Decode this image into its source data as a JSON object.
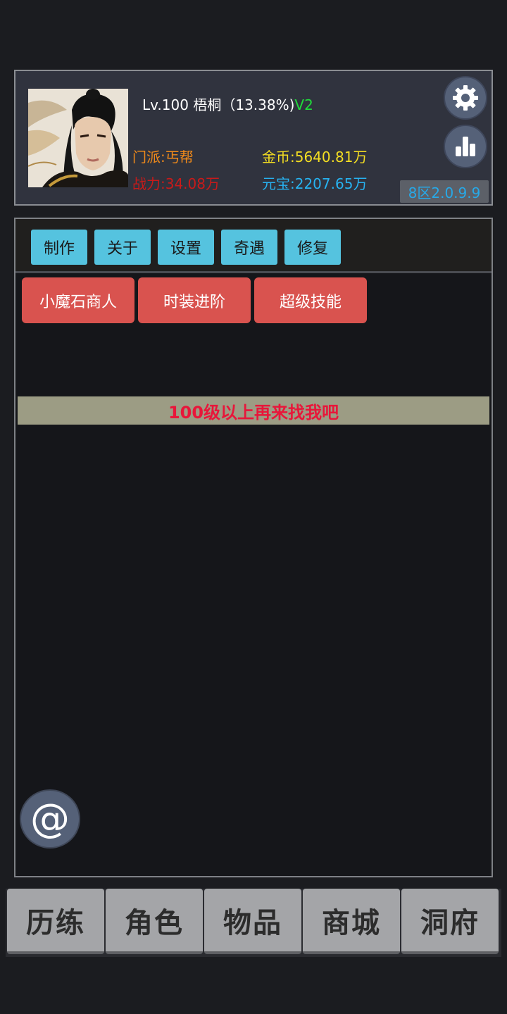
{
  "player": {
    "level_line": "Lv.100 梧桐（13.38%)",
    "vip": "V2",
    "sect": "门派:丐帮",
    "power": "战力:34.08万",
    "gold": "金币:5640.81万",
    "yuanbao": "元宝:2207.65万",
    "server": "8区2.0.9.9"
  },
  "icons": {
    "settings": "gear-icon",
    "rank": "bar-chart-icon",
    "contact": "at-icon"
  },
  "tabs": [
    "制作",
    "关于",
    "设置",
    "奇遇",
    "修复"
  ],
  "functions": [
    "小魔石商人",
    "时装进阶",
    "超级技能"
  ],
  "notice": "100级以上再来找我吧",
  "contact_symbol": "@",
  "bottom_nav": [
    "历练",
    "角色",
    "物品",
    "商城",
    "洞府"
  ],
  "colors": {
    "tab_button": "#55c3df",
    "function_button": "#d9534f",
    "notice_text": "#e8163a",
    "vip": "#1fdc3a",
    "gold": "#f4de22",
    "yuanbao": "#27b2f0",
    "sect": "#f08a1a",
    "power": "#c81a1a"
  }
}
